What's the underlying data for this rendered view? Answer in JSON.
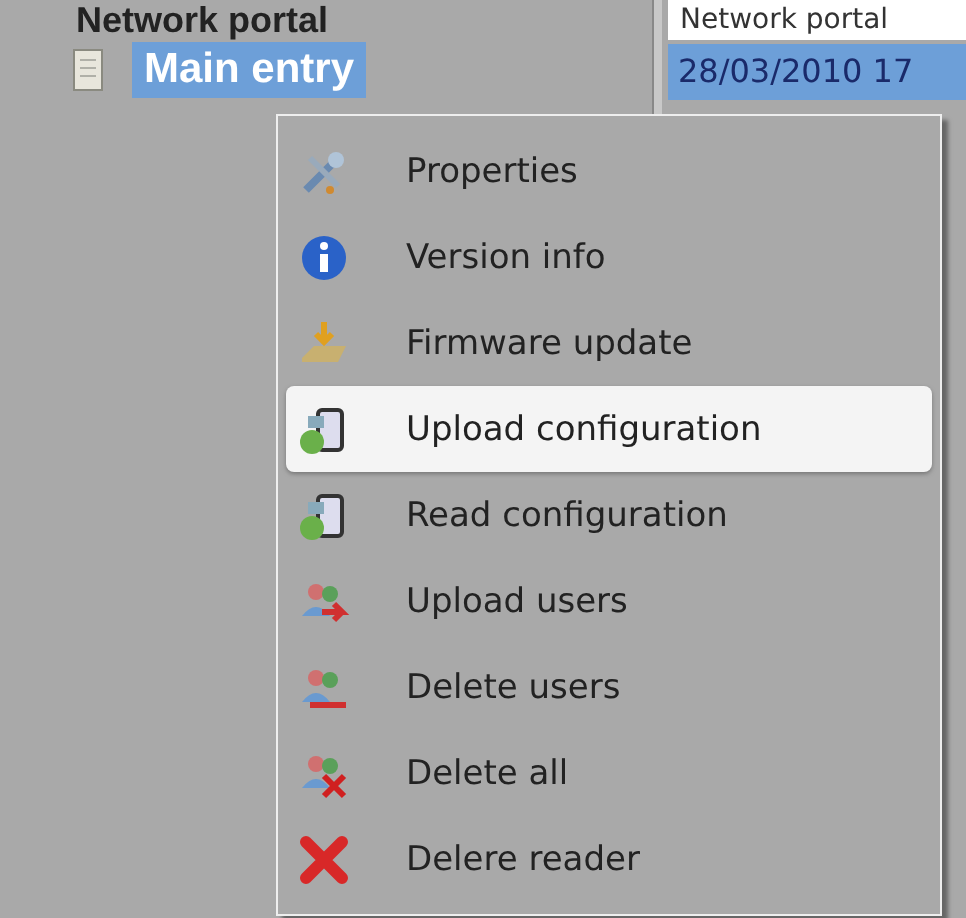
{
  "tree": {
    "root": "Network portal",
    "children": [
      {
        "label": "Main entry",
        "selected": true
      }
    ]
  },
  "list": {
    "header": "Network portal",
    "rows": [
      {
        "text": "28/03/2010 17",
        "selected": true
      }
    ]
  },
  "context_menu": {
    "items": [
      {
        "label": "Properties",
        "kind": "tools",
        "selected": false
      },
      {
        "label": "Version info",
        "kind": "info",
        "selected": false
      },
      {
        "label": "Firmware update",
        "kind": "firmware",
        "selected": false
      },
      {
        "label": "Upload configuration",
        "kind": "upload-config",
        "selected": true
      },
      {
        "label": "Read configuration",
        "kind": "read-config",
        "selected": false
      },
      {
        "label": "Upload users",
        "kind": "upload-users",
        "selected": false
      },
      {
        "label": "Delete users",
        "kind": "delete-users",
        "selected": false
      },
      {
        "label": "Delete all",
        "kind": "delete-all",
        "selected": false
      },
      {
        "label": "Delere reader",
        "kind": "delete-reader",
        "selected": false
      }
    ]
  }
}
